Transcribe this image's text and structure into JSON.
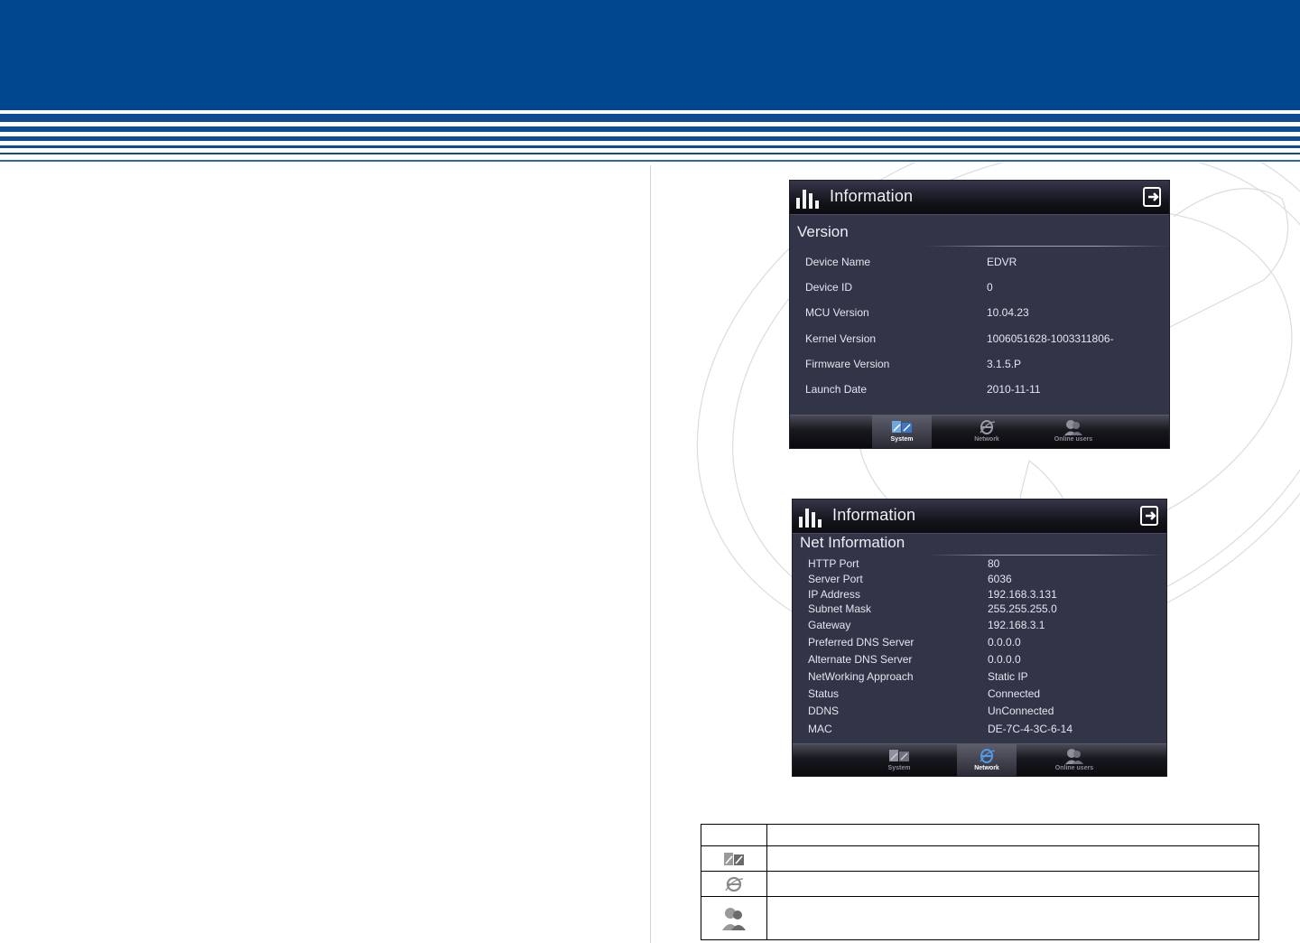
{
  "shot_system": {
    "title": "Information",
    "section": "Version",
    "rows": [
      {
        "label": "Device Name",
        "value": "EDVR"
      },
      {
        "label": "Device ID",
        "value": "0"
      },
      {
        "label": "MCU Version",
        "value": "10.04.23"
      },
      {
        "label": "Kernel Version",
        "value": "1006051628-1003311806-"
      },
      {
        "label": "Firmware Version",
        "value": "3.1.5.P"
      },
      {
        "label": "Launch Date",
        "value": "2010-11-11"
      }
    ],
    "tabs": [
      {
        "label": "System",
        "icon": "system-icon",
        "active": true
      },
      {
        "label": "Network",
        "icon": "network-icon",
        "active": false
      },
      {
        "label": "Online users",
        "icon": "online-users-icon",
        "active": false
      }
    ]
  },
  "shot_network": {
    "title": "Information",
    "section": "Net Information",
    "rows": [
      {
        "label": "HTTP Port",
        "value": "80"
      },
      {
        "label": "Server Port",
        "value": "6036"
      },
      {
        "label": "IP Address",
        "value": "192.168.3.131"
      },
      {
        "label": "Subnet Mask",
        "value": "255.255.255.0"
      },
      {
        "label": "Gateway",
        "value": "192.168.3.1"
      },
      {
        "label": "Preferred DNS Server",
        "value": "0.0.0.0"
      },
      {
        "label": "Alternate DNS Server",
        "value": "0.0.0.0"
      },
      {
        "label": "NetWorking Approach",
        "value": "Static IP"
      },
      {
        "label": "Status",
        "value": "Connected"
      },
      {
        "label": "DDNS",
        "value": "UnConnected"
      },
      {
        "label": "MAC",
        "value": "DE-7C-4-3C-6-14"
      }
    ],
    "tabs": [
      {
        "label": "System",
        "icon": "system-icon",
        "active": false
      },
      {
        "label": "Network",
        "icon": "network-icon",
        "active": true
      },
      {
        "label": "Online users",
        "icon": "online-users-icon",
        "active": false
      }
    ]
  },
  "icon_table": {
    "rows": [
      {
        "icon": "",
        "description": ""
      },
      {
        "icon": "system-icon",
        "description": ""
      },
      {
        "icon": "network-icon",
        "description": ""
      },
      {
        "icon": "online-users-icon",
        "description": ""
      }
    ]
  },
  "colors": {
    "header_blue": "#00478e",
    "panel_bg": "#323448",
    "panel_text": "#e4e6ef"
  }
}
